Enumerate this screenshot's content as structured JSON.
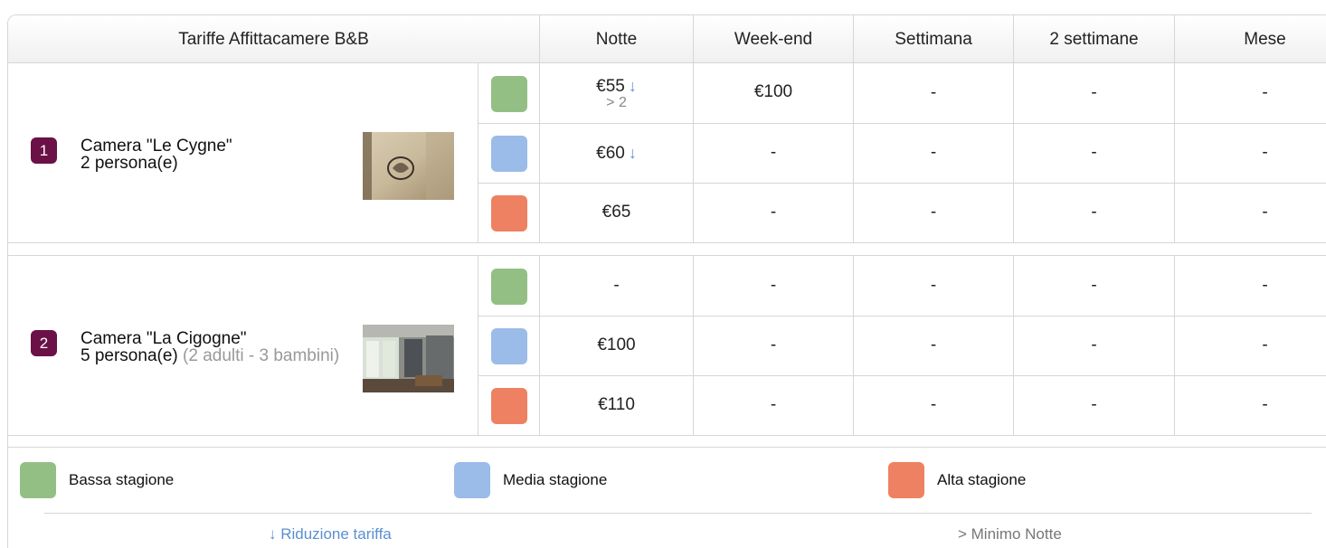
{
  "header": {
    "title": "Tariffe Affittacamere B&B",
    "columns": [
      "Notte",
      "Week-end",
      "Settimana",
      "2 settimane",
      "Mese"
    ]
  },
  "rooms": [
    {
      "number": "1",
      "name": "Camera \"Le Cygne\"",
      "capacity": "2 persona(e)",
      "capacity_detail": "",
      "rows": [
        {
          "season": "bassa",
          "notte": "€55",
          "notte_arrow": "↓",
          "notte_min": "> 2",
          "weekend": "€100",
          "settimana": "-",
          "due_settimane": "-",
          "mese": "-"
        },
        {
          "season": "media",
          "notte": "€60",
          "notte_arrow": "↓",
          "notte_min": "",
          "weekend": "-",
          "settimana": "-",
          "due_settimane": "-",
          "mese": "-"
        },
        {
          "season": "alta",
          "notte": "€65",
          "notte_arrow": "",
          "notte_min": "",
          "weekend": "-",
          "settimana": "-",
          "due_settimane": "-",
          "mese": "-"
        }
      ]
    },
    {
      "number": "2",
      "name": "Camera \"La Cigogne\"",
      "capacity": "5 persona(e)",
      "capacity_detail": "(2 adulti - 3 bambini)",
      "rows": [
        {
          "season": "bassa",
          "notte": "-",
          "notte_arrow": "",
          "notte_min": "",
          "weekend": "-",
          "settimana": "-",
          "due_settimane": "-",
          "mese": "-"
        },
        {
          "season": "media",
          "notte": "€100",
          "notte_arrow": "",
          "notte_min": "",
          "weekend": "-",
          "settimana": "-",
          "due_settimane": "-",
          "mese": "-"
        },
        {
          "season": "alta",
          "notte": "€110",
          "notte_arrow": "",
          "notte_min": "",
          "weekend": "-",
          "settimana": "-",
          "due_settimane": "-",
          "mese": "-"
        }
      ]
    }
  ],
  "legend": {
    "bassa": "Bassa stagione",
    "media": "Media stagione",
    "alta": "Alta stagione",
    "reduction": "↓ Riduzione tariffa",
    "min_nights": "> Minimo Notte"
  },
  "colors": {
    "bassa": "#93bf85",
    "media": "#9bbbe8",
    "alta": "#ee8161",
    "badge": "#6b1147",
    "arrow": "#5b8fd1"
  }
}
